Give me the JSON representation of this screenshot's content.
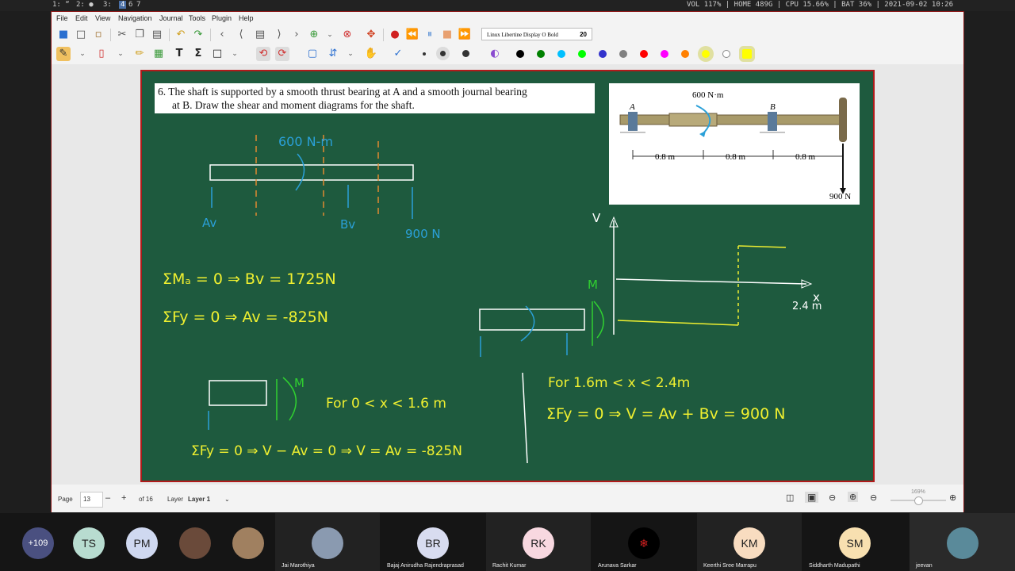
{
  "system_bar": {
    "workspaces": [
      "1: “",
      "2: ●",
      "3:",
      "4",
      "6",
      "7"
    ],
    "status": "VOL 117% | HOME 489G | CPU 15.66% | BAT 36% | 2021-09-02 10:26"
  },
  "menu": [
    "File",
    "Edit",
    "View",
    "Navigation",
    "Journal",
    "Tools",
    "Plugin",
    "Help"
  ],
  "toolbar": {
    "font_name": "Linux Libertine Display O Bold",
    "font_size": "20",
    "icons": [
      "save-icon",
      "new-page-icon",
      "open-icon",
      "cut-icon",
      "copy-icon",
      "paste-icon",
      "undo-icon",
      "redo-icon",
      "first-page-icon",
      "prev-page-icon",
      "goto-page-icon",
      "next-page-icon",
      "last-page-icon",
      "add-page-icon",
      "delete-page-icon",
      "fullscreen-icon",
      "record-icon",
      "rewind-icon",
      "pause-icon",
      "stop-icon",
      "forward-icon"
    ],
    "tool_icons": [
      "pen-icon",
      "eraser-icon",
      "highlighter-icon",
      "image-icon",
      "text-icon",
      "formula-icon",
      "shape-icon",
      "undo-stroke-icon",
      "redo-stroke-icon",
      "select-rect-icon",
      "vertical-space-icon",
      "hand-icon",
      "default-tool-icon"
    ],
    "colors": [
      "#000000",
      "#008000",
      "#00c0ff",
      "#00ff00",
      "#3333cc",
      "#808080",
      "#ff0000",
      "#ff00ff",
      "#ff8000",
      "#ffff00",
      "#ffffff",
      "#ffff00"
    ]
  },
  "board": {
    "problem_text_1": "6.  The shaft is supported by a smooth thrust bearing at A and a smooth journal bearing",
    "problem_text_2": "at B. Draw the shear and moment diagrams for the shaft.",
    "figure": {
      "moment_label": "600 N·m",
      "label_a": "A",
      "label_b": "B",
      "dim_1": "0.8 m",
      "dim_2": "0.8 m",
      "dim_3": "0.8 m",
      "load_label": "900 N"
    },
    "hand": {
      "moment": "600 N-m",
      "av": "Av",
      "bv": "Bv",
      "load": "900 N",
      "eq1": "ΣMₐ = 0 ⇒ Bv = 1725N",
      "eq2": "ΣFy = 0 ⇒ Av = -825N",
      "v_axis": "V",
      "x_axis": "x",
      "x_end": "2.4 m",
      "m_label": "M",
      "for1": "For  0 < x < 1.6 m",
      "eq3": "ΣFy = 0 ⇒ V − Av = 0 ⇒ V = Av = -825N",
      "for2": "For  1.6m < x < 2.4m",
      "eq4": "ΣFy = 0 ⇒ V = Av + Bv = 900 N"
    }
  },
  "footer": {
    "page_label": "Page",
    "page_value": "13",
    "of_pages": "of 16",
    "layer_label": "Layer",
    "layer_value": "Layer 1",
    "zoom": "169%"
  },
  "participants": [
    {
      "initials": "+109",
      "name": "",
      "color": "#4a5080"
    },
    {
      "initials": "TS",
      "name": "",
      "color": "#b8dcd0"
    },
    {
      "initials": "PM",
      "name": "",
      "color": "#cfd8f0"
    },
    {
      "initials": "",
      "name": "",
      "color": "#6a4a3a"
    },
    {
      "initials": "",
      "name": "",
      "color": "#a08060"
    },
    {
      "initials": "",
      "name": "Jai Marothiya",
      "color": "#8a9ab0"
    },
    {
      "initials": "BR",
      "name": "Bajaj Anirudha Rajendraprasad",
      "color": "#d8dcf0"
    },
    {
      "initials": "RK",
      "name": "Rachit Kumar",
      "color": "#f8d8e0"
    },
    {
      "initials": "",
      "name": "Arunava Sarkar",
      "color": "#000000"
    },
    {
      "initials": "KM",
      "name": "Keerthi Sree Marrapu",
      "color": "#f8dcc0"
    },
    {
      "initials": "SM",
      "name": "Siddharth Madupathi",
      "color": "#f8e0b0"
    },
    {
      "initials": "",
      "name": "jeevan",
      "color": "#5a8a9a"
    }
  ]
}
